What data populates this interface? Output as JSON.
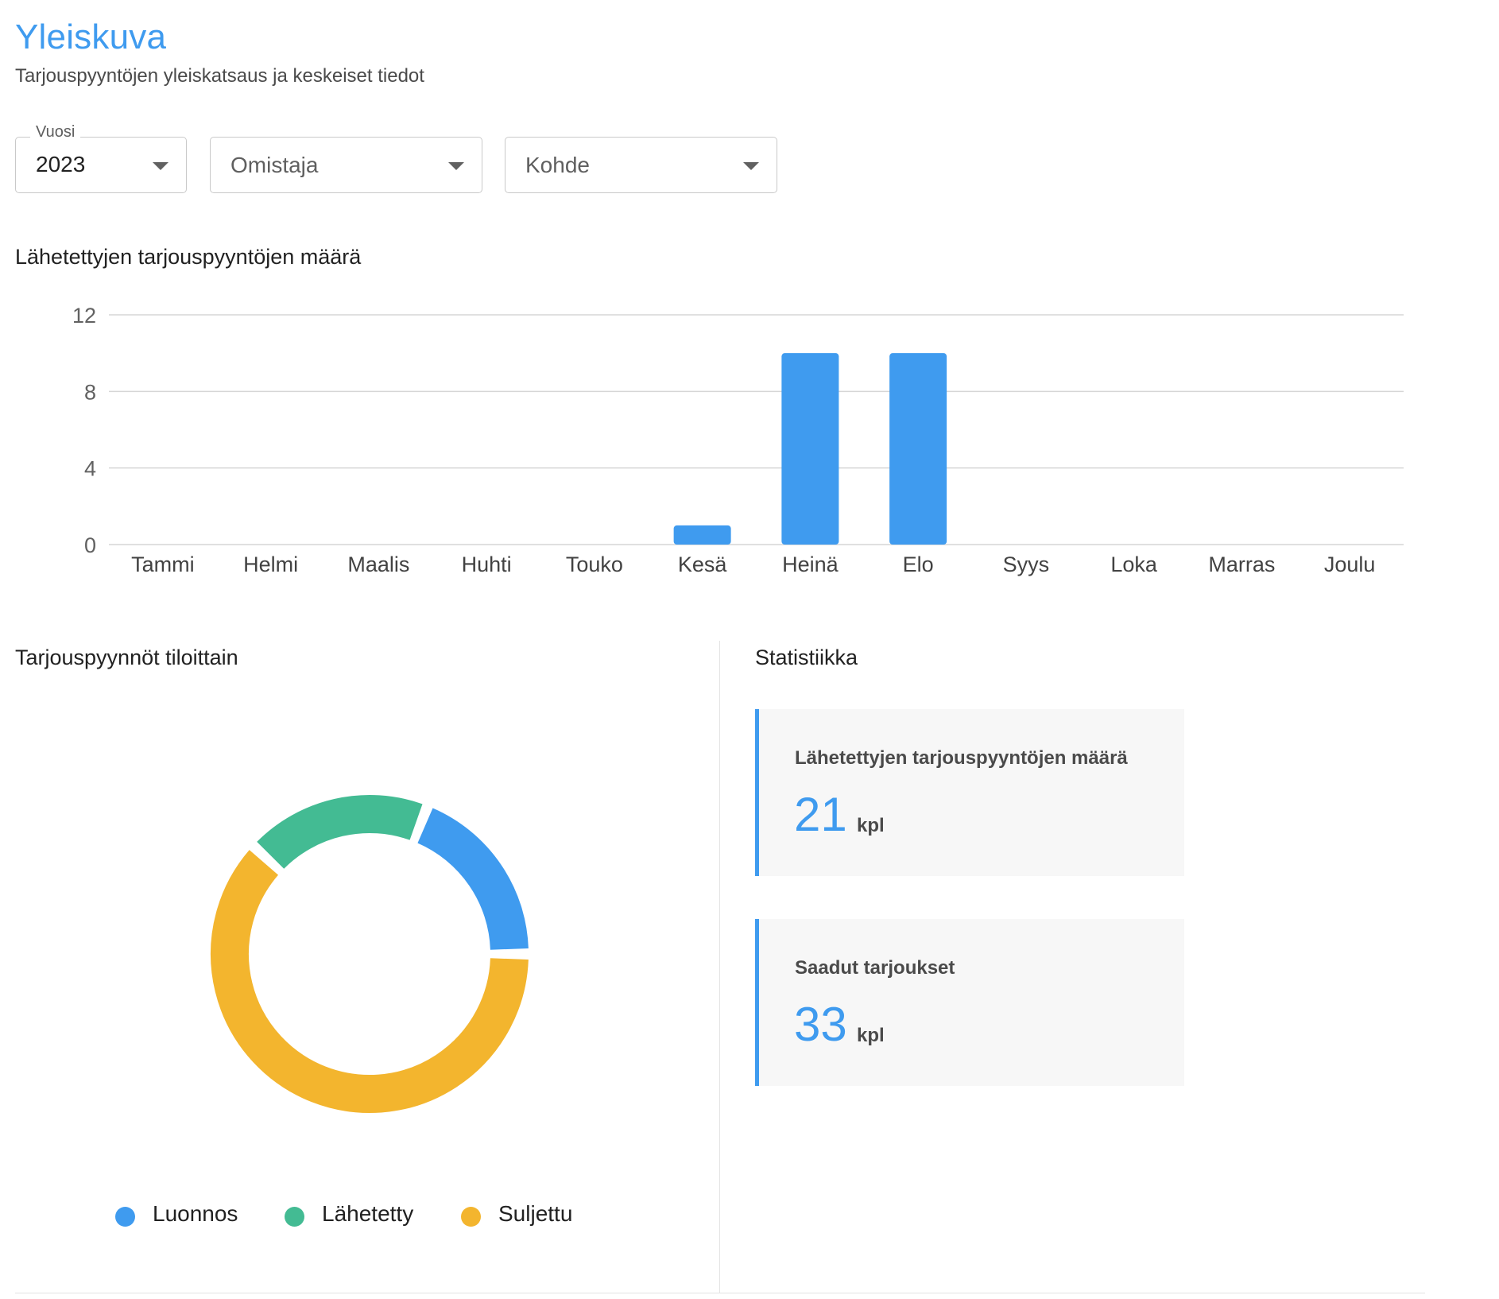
{
  "header": {
    "title": "Yleiskuva",
    "subtitle": "Tarjouspyyntöjen yleiskatsaus ja keskeiset tiedot"
  },
  "filters": {
    "year": {
      "label": "Vuosi",
      "value": "2023"
    },
    "owner": {
      "placeholder": "Omistaja"
    },
    "target": {
      "placeholder": "Kohde"
    }
  },
  "sections": {
    "bar_chart_title": "Lähetettyjen tarjouspyyntöjen määrä",
    "donut_title": "Tarjouspyynnöt tiloittain",
    "stats_title": "Statistiikka"
  },
  "stats": [
    {
      "label": "Lähetettyjen tarjouspyyntöjen määrä",
      "value": "21",
      "unit": "kpl"
    },
    {
      "label": "Saadut tarjoukset",
      "value": "33",
      "unit": "kpl"
    }
  ],
  "colors": {
    "accent": "#3f9bef",
    "draft": "#3f9bef",
    "sent": "#43bb93",
    "closed": "#f3b52e",
    "grid": "#d6d6d6"
  },
  "chart_data": [
    {
      "type": "bar",
      "title": "Lähetettyjen tarjouspyyntöjen määrä",
      "categories": [
        "Tammi",
        "Helmi",
        "Maalis",
        "Huhti",
        "Touko",
        "Kesä",
        "Heinä",
        "Elo",
        "Syys",
        "Loka",
        "Marras",
        "Joulu"
      ],
      "values": [
        0,
        0,
        0,
        0,
        0,
        1,
        10,
        10,
        0,
        0,
        0,
        0
      ],
      "yticks": [
        0,
        4,
        8,
        12
      ],
      "ylim": [
        0,
        12
      ],
      "grid": true,
      "color": "#3f9bef"
    },
    {
      "type": "pie",
      "title": "Tarjouspyynnöt tiloittain",
      "labels": [
        "Luonnos",
        "Lähetetty",
        "Suljettu"
      ],
      "values": [
        4,
        4,
        13
      ],
      "colors": [
        "#3f9bef",
        "#43bb93",
        "#f3b52e"
      ],
      "legend": "bottom"
    }
  ]
}
